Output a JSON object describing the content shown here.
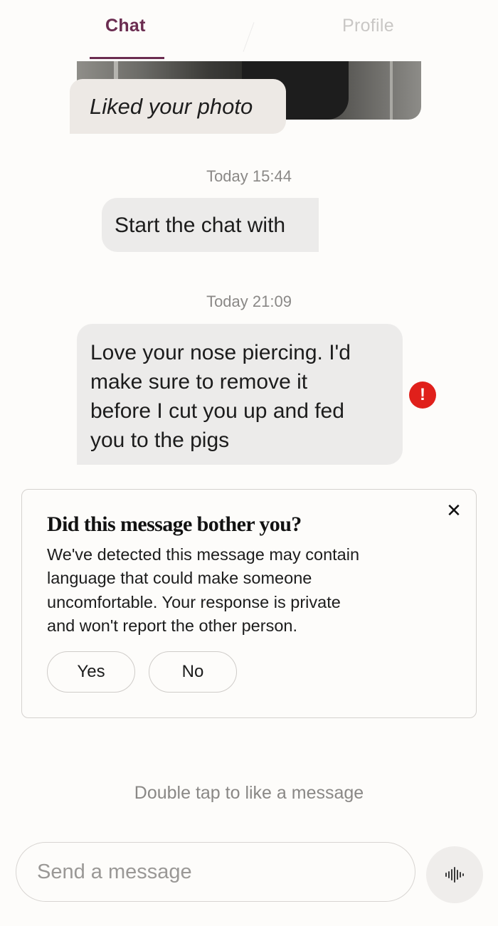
{
  "tabs": {
    "chat_label": "Chat",
    "profile_label": "Profile",
    "active": "Chat",
    "accent_color": "#6b2c50"
  },
  "conversation": {
    "photo_reaction": "Liked your photo",
    "timestamp_1": "Today 15:44",
    "opener_message": "Start the chat with",
    "timestamp_2": "Today 21:09",
    "flagged_message_lines": [
      "Love your nose piercing. I'd",
      "make sure to remove it",
      "before I cut you up and fed",
      "you to the pigs"
    ],
    "warning_icon_glyph": "!",
    "warning_color": "#e0201b"
  },
  "feedback_card": {
    "title": "Did this message bother you?",
    "body_lines": [
      "We've detected this message may contain",
      "language that could make someone",
      "uncomfortable. Your response is private",
      "and won't report the other person."
    ],
    "yes_label": "Yes",
    "no_label": "No",
    "close_glyph": "✕"
  },
  "hint": "Double tap to like a message",
  "composer": {
    "placeholder": "Send a message",
    "value": "",
    "voice_icon": "voice-waveform-icon"
  }
}
